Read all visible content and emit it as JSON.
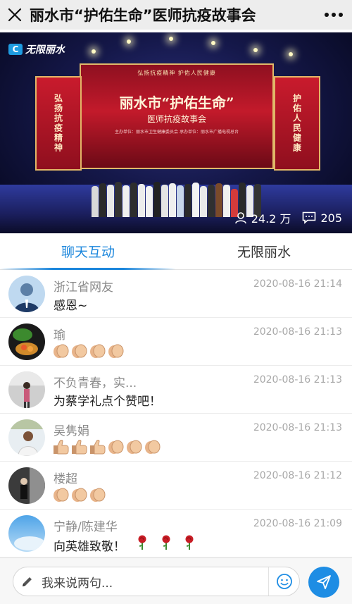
{
  "titlebar": {
    "title": "丽水市“护佑生命”医师抗疫故事会",
    "close_icon": "close-icon",
    "more_icon": "more-icon"
  },
  "video": {
    "channel_logo": "无限丽水",
    "screen_subtitle_top": "弘扬抗疫精神    护佑人民健康",
    "screen_title": "丽水市“护佑生命”",
    "screen_subtitle": "医师抗疫故事会",
    "screen_footer": "主办单位：丽水市卫生健康委员会    承办单位：丽水市广播电视总台",
    "left_banner": "弘扬抗疫精神",
    "right_banner": "护佑人民健康",
    "viewers": "24.2 万",
    "comments": "205"
  },
  "tabs": [
    {
      "label": "聊天互动",
      "active": true
    },
    {
      "label": "无限丽水",
      "active": false
    }
  ],
  "messages": [
    {
      "name": "浙江省网友",
      "time": "2020-08-16 21:14",
      "text": "感恩~",
      "emoji": []
    },
    {
      "name": "瑜",
      "time": "2020-08-16 21:13",
      "text": "",
      "emoji": [
        "clap-icon",
        "clap-icon",
        "clap-icon",
        "clap-icon"
      ]
    },
    {
      "name": "不负青春，实...",
      "time": "2020-08-16 21:13",
      "text": "为蔡学礼点个赞吧！",
      "emoji": []
    },
    {
      "name": "吴隽娟",
      "time": "2020-08-16 21:13",
      "text": "",
      "emoji": [
        "thumbs-up-icon",
        "thumbs-up-icon",
        "thumbs-up-icon",
        "clap-icon",
        "clap-icon",
        "clap-icon"
      ]
    },
    {
      "name": "楼超",
      "time": "2020-08-16 21:12",
      "text": "",
      "emoji": [
        "clap-icon",
        "clap-icon",
        "clap-icon"
      ]
    },
    {
      "name": "宁静/陈建华",
      "time": "2020-08-16 21:09",
      "text": "向英雄致敬！",
      "emoji": [
        "rose-icon",
        "rose-icon",
        "rose-icon"
      ]
    }
  ],
  "composer": {
    "placeholder": "我来说两句...",
    "emoji_icon": "smiley-icon",
    "send_icon": "send-icon"
  },
  "colors": {
    "accent": "#1b86dc",
    "send_button": "#1e8de4"
  }
}
